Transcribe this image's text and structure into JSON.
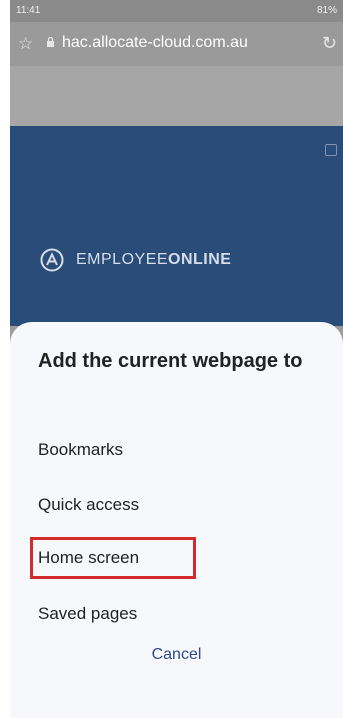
{
  "status_bar": {
    "time": "11:41",
    "battery": "81%"
  },
  "browser": {
    "url": "hac.allocate-cloud.com.au"
  },
  "page": {
    "brand": {
      "first": "EMPLOYEE",
      "second": "ONLINE"
    }
  },
  "sheet": {
    "title": "Add the current webpage to",
    "options": [
      "Bookmarks",
      "Quick access",
      "Home screen",
      "Saved pages"
    ],
    "cancel_label": "Cancel"
  },
  "colors": {
    "highlight": "#d32a2a",
    "page_bg": "#2a4c78",
    "cancel": "#2f4b8c"
  },
  "icons": [
    "star-icon",
    "lock-icon",
    "reload-icon",
    "tabs-icon",
    "logo-icon"
  ]
}
